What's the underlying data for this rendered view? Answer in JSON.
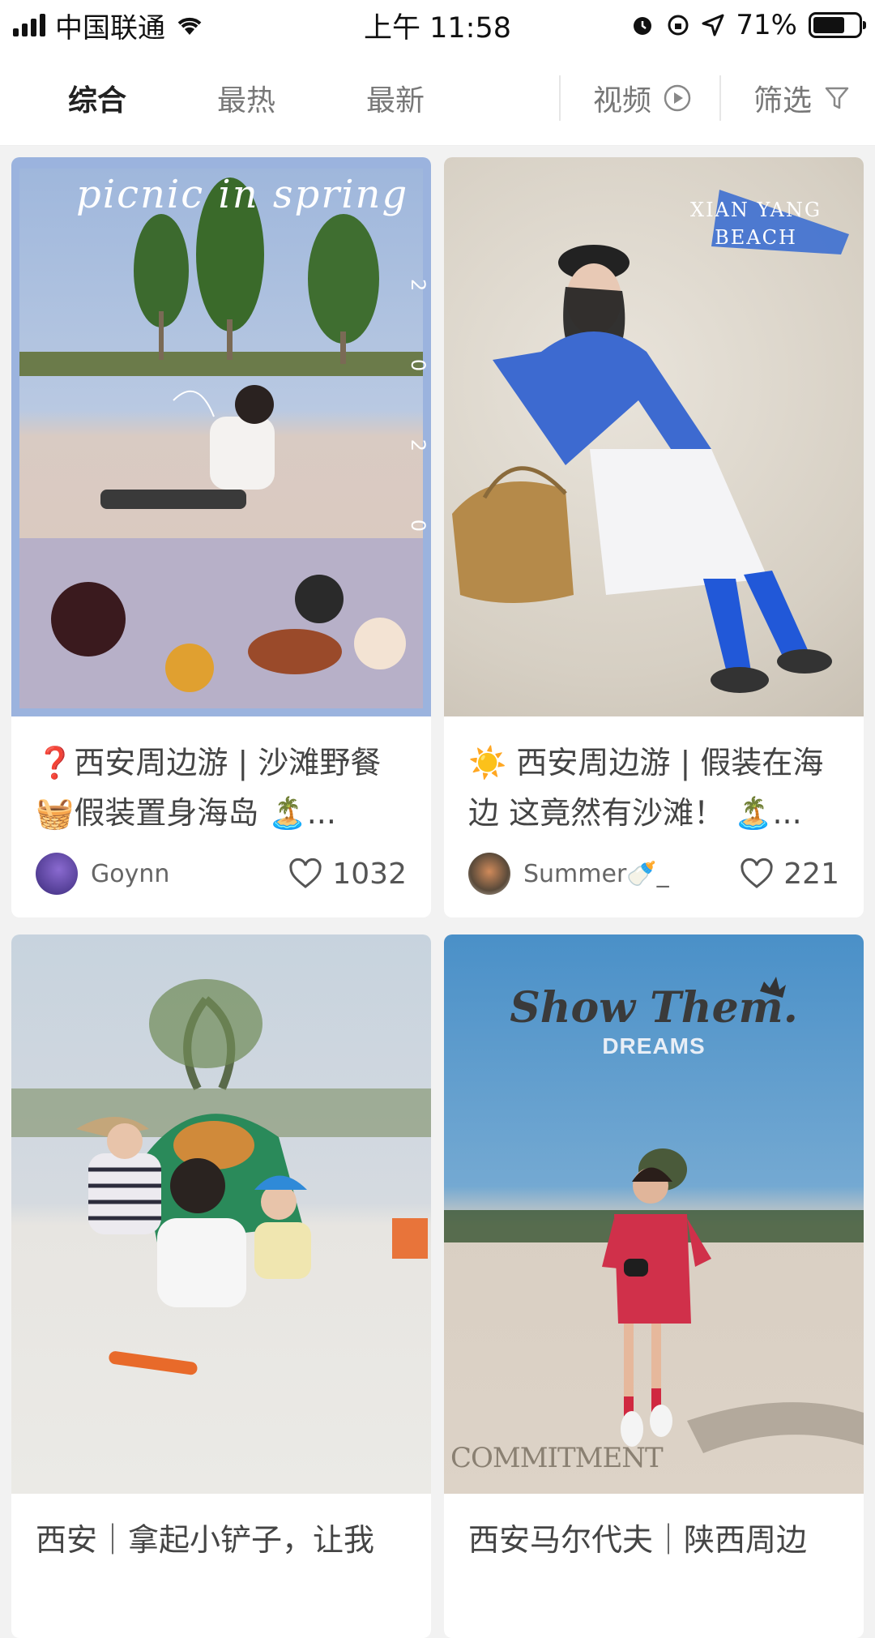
{
  "status_bar": {
    "carrier": "中国联通",
    "time": "上午 11:58",
    "battery_percent": "71%",
    "battery_level": 0.71
  },
  "tabs": {
    "items": [
      {
        "label": "综合",
        "active": true
      },
      {
        "label": "最热",
        "active": false
      },
      {
        "label": "最新",
        "active": false
      }
    ],
    "video_label": "视频",
    "filter_label": "筛选"
  },
  "cards": [
    {
      "image_text": "picnic in spring",
      "image_side_text": "2 0 2 0",
      "title": "❓西安周边游 | 沙滩野餐🧺假装置身海岛 🏝️...",
      "author": "Goynn",
      "likes": "1032"
    },
    {
      "image_text": "XIAN YANG BEACH",
      "title": "☀️ 西安周边游 | 假装在海边 这竟然有沙滩！ 🏝️...",
      "author": "Summer🍼_",
      "likes": "221"
    },
    {
      "title": "西安｜拿起小铲子，让我"
    },
    {
      "image_text": "Show Them.",
      "image_subtext": "DREAMS",
      "image_bottom_text": "COMMITMENT",
      "title": "西安马尔代夫｜陕西周边"
    }
  ],
  "colors": {
    "accent_blue": "#3d6fd0",
    "card_bg": "#ffffff",
    "page_bg": "#f2f2f2"
  }
}
